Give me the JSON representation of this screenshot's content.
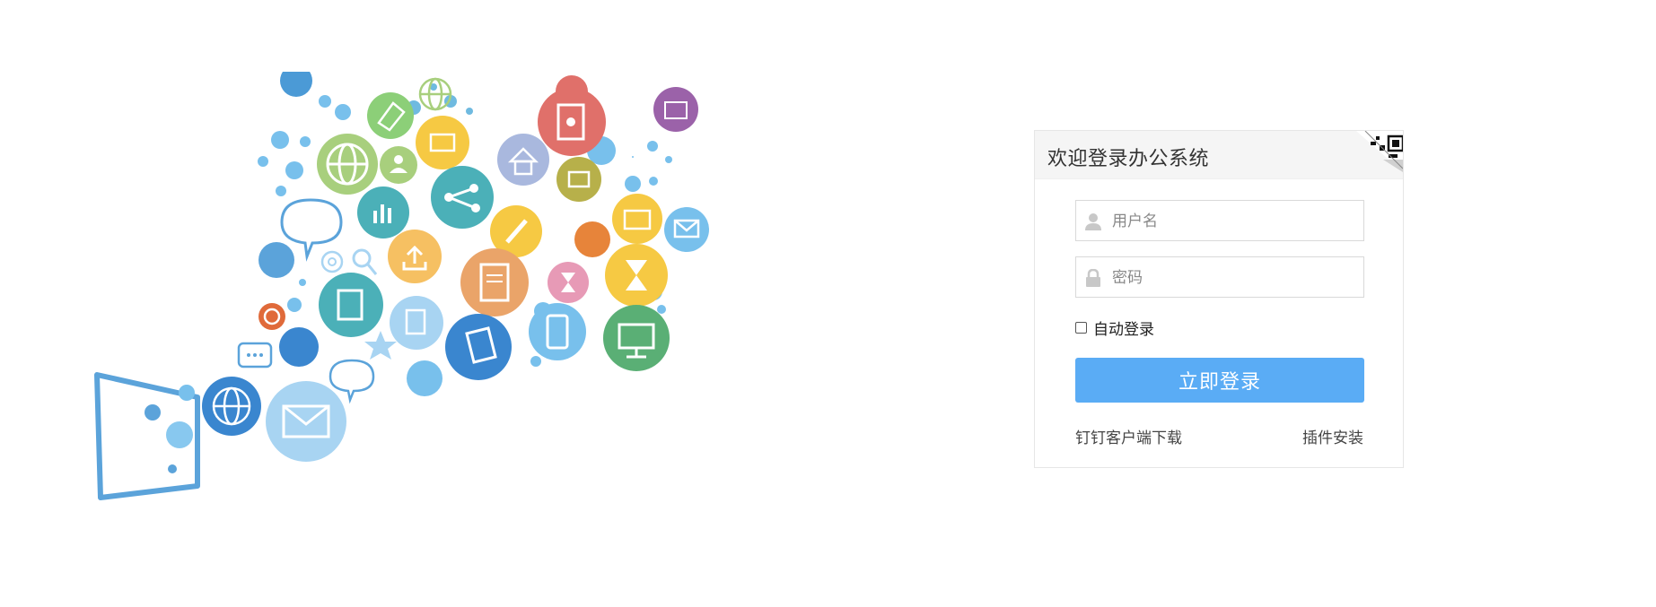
{
  "login": {
    "title": "欢迎登录办公系统",
    "username_placeholder": "用户名",
    "password_placeholder": "密码",
    "remember_label": "自动登录",
    "submit_label": "立即登录",
    "download_link": "钉钉客户端下载",
    "plugin_link": "插件安装"
  },
  "icons": {
    "qr_corner": "qr-code-icon",
    "username": "user-icon",
    "password": "lock-icon"
  },
  "colors": {
    "primary": "#5aacf5",
    "header_bg": "#f5f5f5",
    "border": "#e6e6e6"
  }
}
